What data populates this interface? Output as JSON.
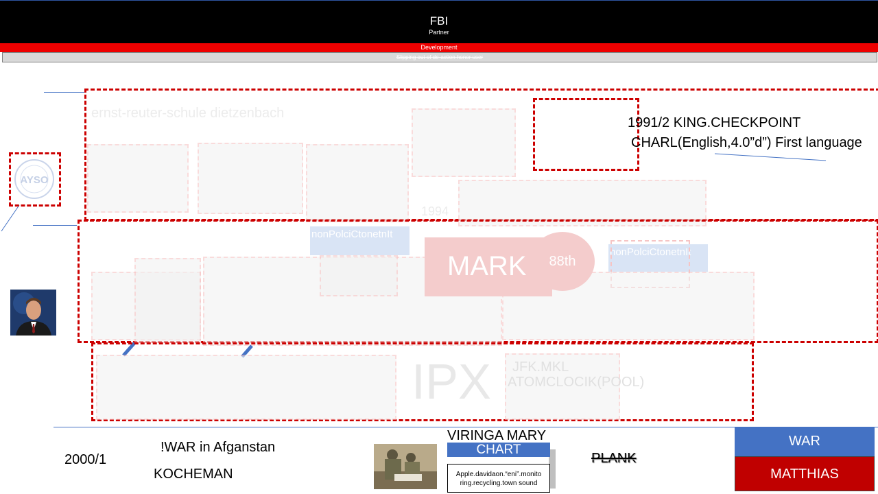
{
  "header": {
    "title": "FBI",
    "subtitle": "Partner"
  },
  "dev_bar": {
    "label": "Development"
  },
  "grey_bar": {
    "label": "Slipping out of de-action honor user"
  },
  "school": {
    "label": "ernst-reuter-schule dietzenbach"
  },
  "notes": {
    "line1": "1991/2 KING.CHECKPOINT",
    "line2": "CHARL(English,4.0”d”) First language"
  },
  "ghost_year": "1994",
  "tag_left": "nonPolciCtonetnIt",
  "tag_right": "nonPolciCtonetnIt",
  "mark": {
    "label": "MARK",
    "badge": "88th"
  },
  "ipx": "IPX",
  "jfk": {
    "line1": "JFK.MKL",
    "line2": "ATOMCLOCIK(POOL)"
  },
  "bottom": {
    "year": "2000/1",
    "war_afg": "!WAR in Afganstan",
    "kocheman": "KOCHEMAN",
    "viringa": "VIRINGA MARY",
    "chart": "CHART",
    "apple_line1": "Apple.davidaon.“eni”.monito",
    "apple_line2": "ring.recycling.town sound",
    "plank": "PLANK",
    "war_btn": "WAR",
    "matthias_btn": "MATTHIAS"
  },
  "colors": {
    "header_bg": "#000000",
    "dev_red": "#ee0000",
    "dash_red": "#cc0000",
    "war_blue": "#4472c4",
    "matthias_red": "#c00000"
  }
}
